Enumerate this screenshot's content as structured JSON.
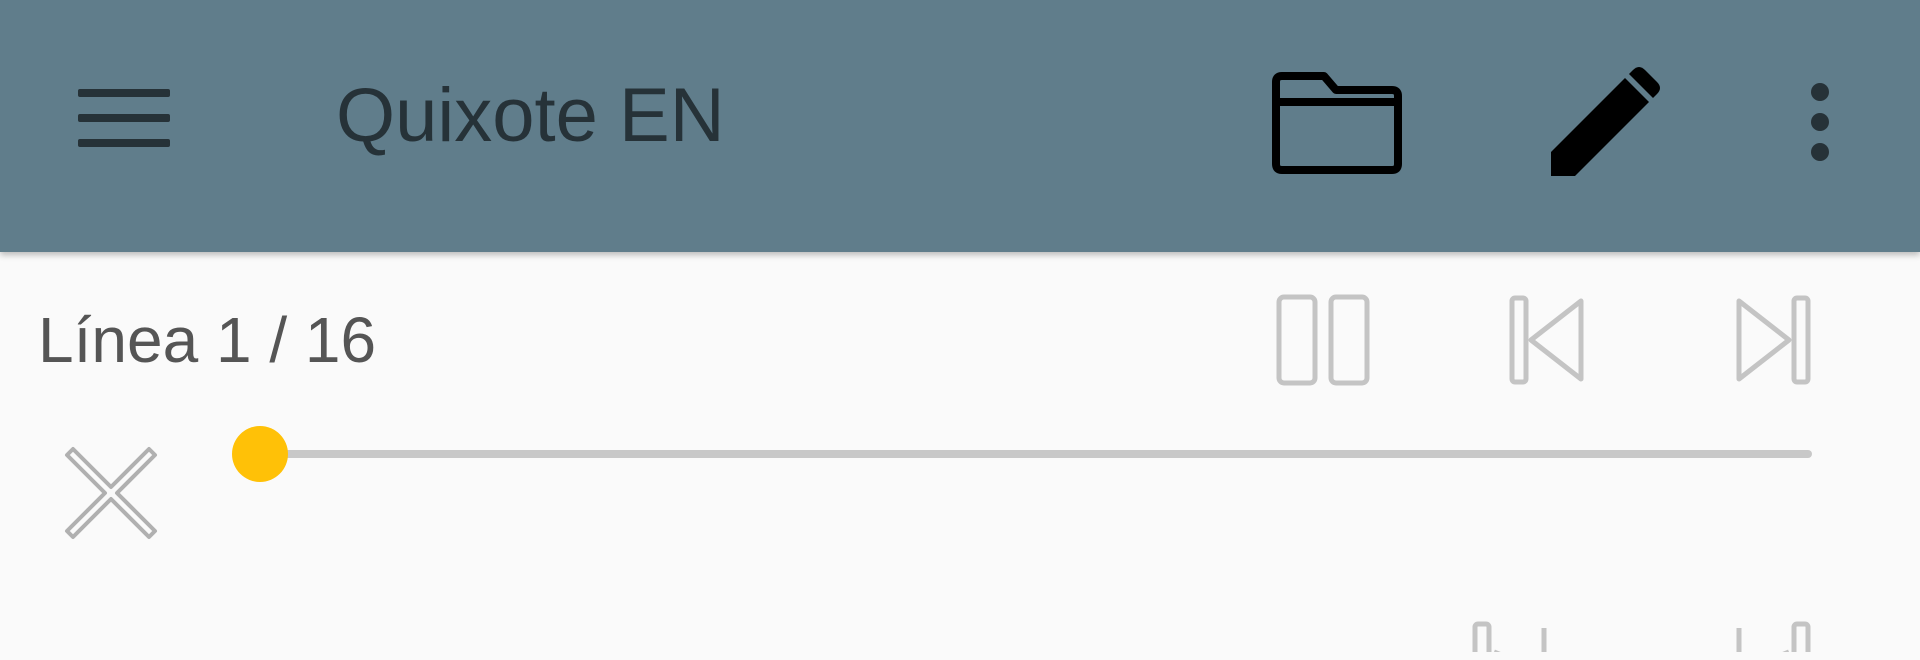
{
  "appbar": {
    "title": "Quixote EN",
    "background_color": "#607d8b",
    "title_color": "#263238",
    "actions": [
      {
        "name": "menu",
        "icon": "hamburger-menu-icon"
      },
      {
        "name": "open-folder",
        "icon": "folder-icon"
      },
      {
        "name": "edit",
        "icon": "pencil-icon"
      },
      {
        "name": "more-options",
        "icon": "more-vert-icon"
      }
    ]
  },
  "player": {
    "line_label": "Línea 1 / 16",
    "current_line": 1,
    "total_lines": 16,
    "progress_fraction": 0.0,
    "accent_color": "#ffc107",
    "controls": [
      {
        "name": "pause",
        "icon": "pause-icon"
      },
      {
        "name": "previous",
        "icon": "skip-previous-icon"
      },
      {
        "name": "next",
        "icon": "skip-next-icon"
      },
      {
        "name": "close",
        "icon": "close-icon"
      }
    ]
  }
}
